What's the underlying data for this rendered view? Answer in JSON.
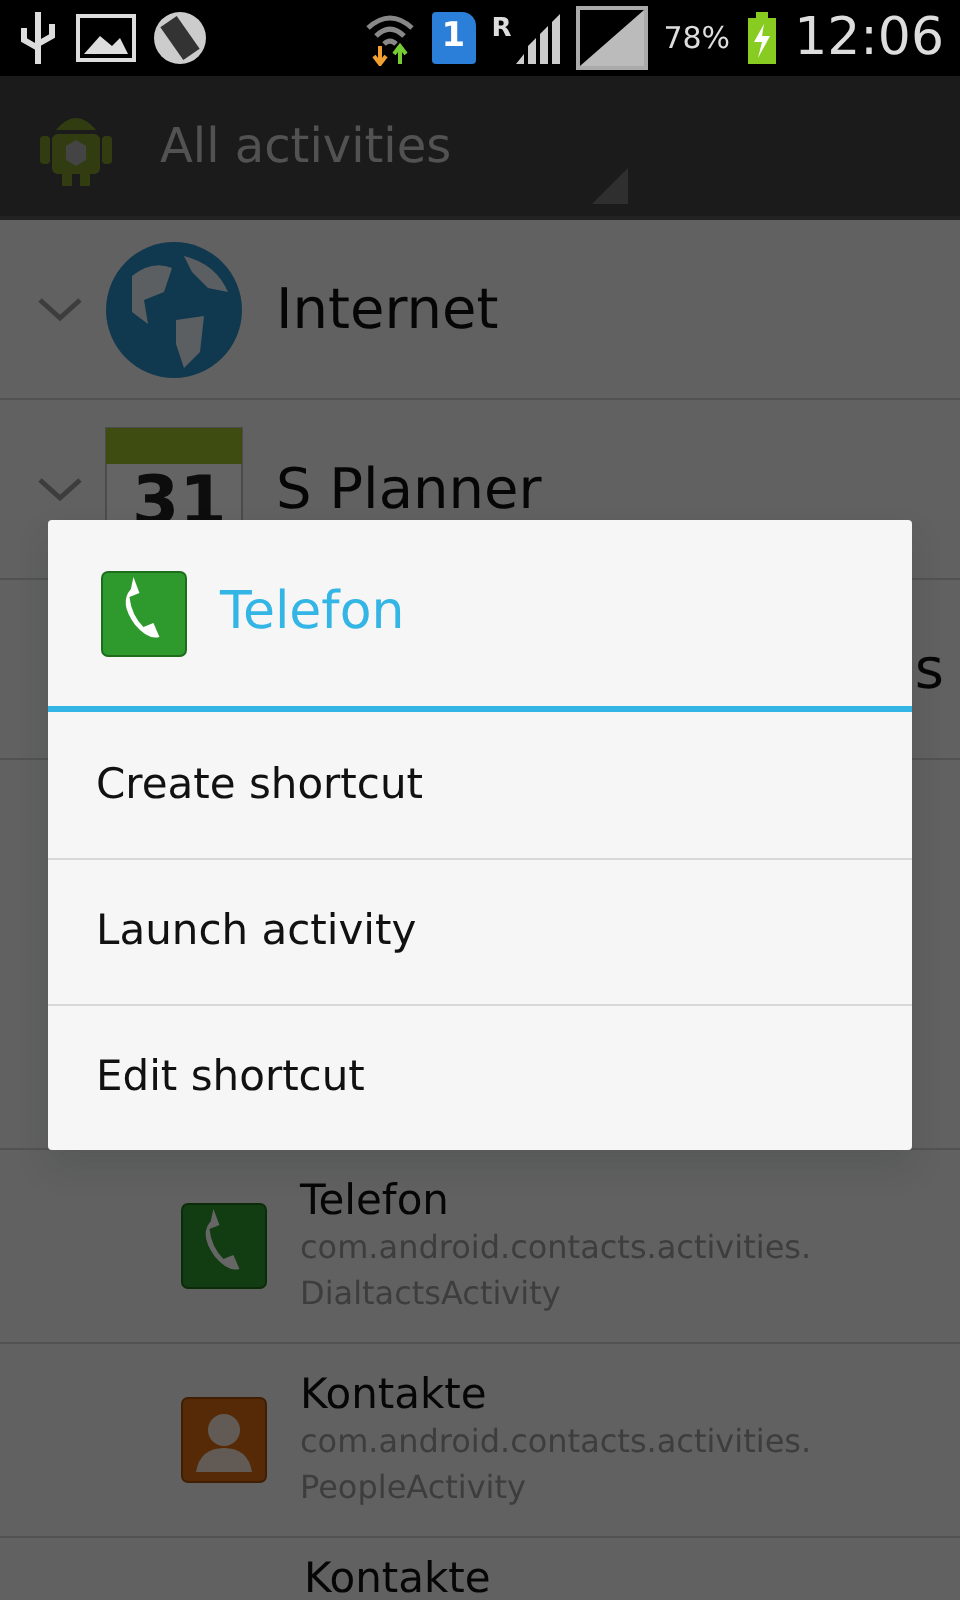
{
  "status_bar": {
    "sim": "1",
    "roaming": "R",
    "battery_text": "78%",
    "time": "12:06"
  },
  "action_bar": {
    "title": "All activities"
  },
  "groups": [
    {
      "label": "Internet",
      "kind": "globe"
    },
    {
      "label": "S Planner",
      "kind": "calendar",
      "icon_text": "31"
    },
    {
      "label": "s",
      "kind": "covered"
    }
  ],
  "activities": [
    {
      "label": "Telefon",
      "detail": "com.android.contacts.activities.\nDialtactsActivity",
      "kind": "phone"
    },
    {
      "label": "Kontakte",
      "detail": "com.android.contacts.activities.\nPeopleActivity",
      "kind": "contact"
    },
    {
      "label": "Kontakte",
      "kind": "cut"
    }
  ],
  "dialog": {
    "title": "Telefon",
    "kind": "phone",
    "items": [
      "Create shortcut",
      "Launch activity",
      "Edit shortcut"
    ]
  }
}
